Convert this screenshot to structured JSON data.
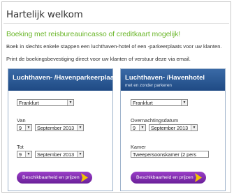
{
  "header": {
    "title": "Hartelijk welkom",
    "subtitle": "Boeking met reisbureauincasso of creditkaart mogelijk!",
    "line1": "Boek in slechts enkele stappen een luchthaven-hotel of een -parkeerplaats voor uw klanten.",
    "line2": "Print de boekingsbevestiging direct voor uw klanten of verstuur deze via email."
  },
  "parking": {
    "title": "Luchthaven- /Havenparkeerplaats",
    "location": "Frankfurt",
    "from_label": "Van",
    "from_day": "9",
    "from_month": "September 2013",
    "to_label": "Tot",
    "to_day": "9",
    "to_month": "September 2013",
    "button": "Beschikbaarheid en prijzen"
  },
  "hotel": {
    "title": "Luchthaven- /Havenhotel",
    "subtitle": "met en zonder parkeren",
    "location": "Frankfurt",
    "date_label": "Overnachtingsdatum",
    "day": "9",
    "month": "September 2013",
    "room_label": "Kamer",
    "room": "Tweepersoonskamer (2 pers",
    "button": "Beschikbaarheid en prijzen"
  },
  "colors": {
    "accent_green": "#6cb72c",
    "panel_blue": "#2a5790",
    "button_purple": "#7e2fb0",
    "arrow_yellow": "#f2c400"
  }
}
